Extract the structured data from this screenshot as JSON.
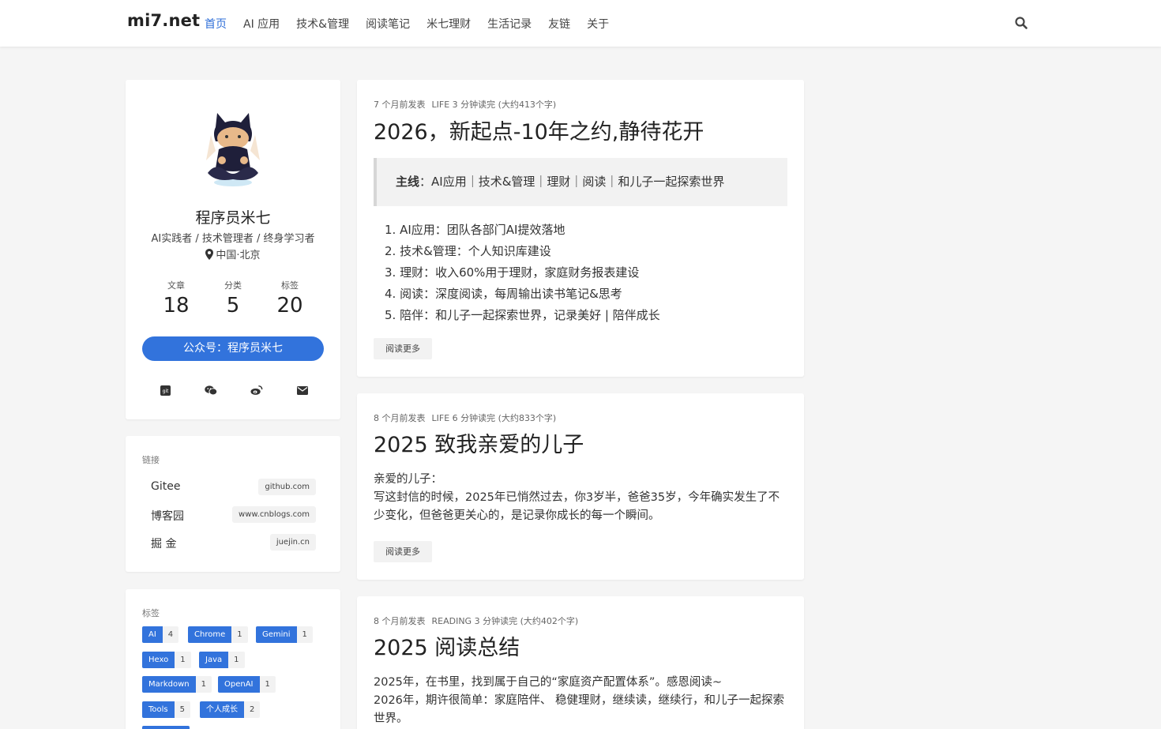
{
  "header": {
    "brand": "mi7.net",
    "nav": [
      "首页",
      "AI 应用",
      "技术&管理",
      "阅读笔记",
      "米七理财",
      "生活记录",
      "友链",
      "关于"
    ],
    "active_index": 0,
    "search_icon": "search-icon"
  },
  "profile": {
    "avatar_icon": "octocat-avatar",
    "name": "程序员米七",
    "bio": "AI实践者 / 技术管理者 / 终身学习者",
    "location": "中国·北京",
    "location_icon": "map-marker-icon",
    "stats": [
      {
        "label": "文章",
        "value": "18"
      },
      {
        "label": "分类",
        "value": "5"
      },
      {
        "label": "标签",
        "value": "20"
      }
    ],
    "follow_label": "公众号：程序员米七",
    "socials": [
      "git-icon",
      "wechat-icon",
      "weibo-icon",
      "email-icon"
    ]
  },
  "links": {
    "title": "链接",
    "items": [
      {
        "name": "Gitee",
        "host": "github.com"
      },
      {
        "name": "博客园",
        "host": "www.cnblogs.com"
      },
      {
        "name": "掘 金",
        "host": "juejin.cn"
      }
    ]
  },
  "tags": {
    "title": "标签",
    "items": [
      {
        "name": "AI",
        "count": "4"
      },
      {
        "name": "Chrome",
        "count": "1"
      },
      {
        "name": "Gemini",
        "count": "1"
      },
      {
        "name": "Hexo",
        "count": "1"
      },
      {
        "name": "Java",
        "count": "1"
      },
      {
        "name": "Markdown",
        "count": "1"
      },
      {
        "name": "OpenAI",
        "count": "1"
      },
      {
        "name": "Tools",
        "count": "5"
      },
      {
        "name": "个人成长",
        "count": "2"
      }
    ]
  },
  "posts": [
    {
      "date": "7 个月前发表",
      "category": "LIFE",
      "reading": "3 分钟读完 (大约413个字)",
      "title": "2026，新起点-10年之约,静待花开",
      "quote_bold": "主线",
      "quote_rest": "：AI应用｜技术&管理｜理财｜阅读｜和儿子一起探索世界",
      "list": [
        "AI应用：团队各部门AI提效落地",
        "技术&管理：个人知识库建设",
        "理财：收入60%用于理财，家庭财务报表建设",
        "阅读：深度阅读，每周输出读书笔记&思考",
        "陪伴：和儿子一起探索世界，记录美好 | 陪伴成长"
      ],
      "more": "阅读更多"
    },
    {
      "date": "8 个月前发表",
      "category": "LIFE",
      "reading": "6 分钟读完 (大约833个字)",
      "title": "2025 致我亲爱的儿子",
      "para1": "亲爱的儿子：",
      "para2": "写这封信的时候，2025年已悄然过去，你3岁半，爸爸35岁，今年确实发生了不少变化，但爸爸更关心的，是记录你成长的每一个瞬间。",
      "more": "阅读更多"
    },
    {
      "date": "8 个月前发表",
      "category": "READING",
      "reading": "3 分钟读完 (大约402个字)",
      "title": "2025 阅读总结",
      "para1": "2025年，在书里，找到属于自己的“家庭资产配置体系”。感恩阅读~",
      "para2": "2026年，期许很简单：家庭陪伴、 稳健理财，继续读，继续行，和儿子一起探索世界。"
    }
  ]
}
